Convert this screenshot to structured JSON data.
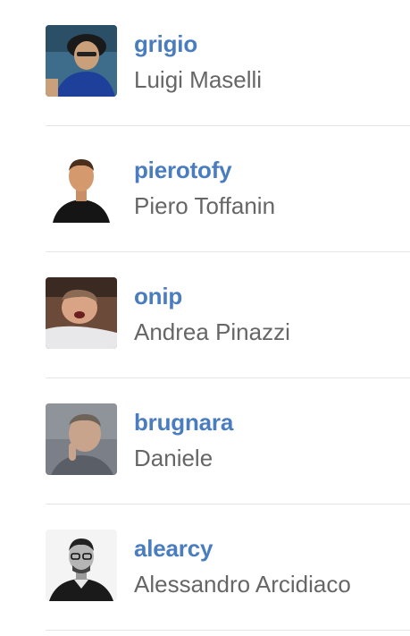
{
  "users": [
    {
      "username": "grigio",
      "full_name": "Luigi Maselli"
    },
    {
      "username": "pierotofy",
      "full_name": "Piero Toffanin"
    },
    {
      "username": "onip",
      "full_name": "Andrea Pinazzi"
    },
    {
      "username": "brugnara",
      "full_name": "Daniele"
    },
    {
      "username": "alearcy",
      "full_name": "Alessandro Arcidiaco"
    }
  ],
  "colors": {
    "username_link": "#4a7dbf",
    "full_name_text": "#666666",
    "divider": "#e4e4e4"
  }
}
